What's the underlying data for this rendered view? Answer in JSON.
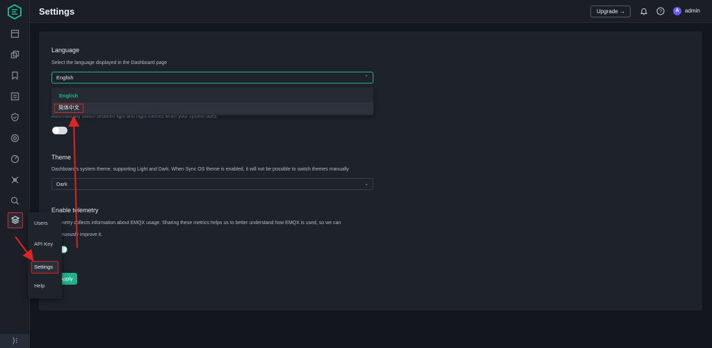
{
  "header": {
    "title": "Settings",
    "upgrade_label": "Upgrade",
    "avatar_letter": "A",
    "user": "admin"
  },
  "settings": {
    "language_label": "Language",
    "language_desc": "Select the language displayed in the Dashboard page",
    "language_value": "English",
    "language_options": [
      "English",
      "简体中文"
    ],
    "sync_desc_tail": "Automatically switch between light and night themes when your system does.",
    "theme_label": "Theme",
    "theme_desc": "Dashboard's system theme, supporting Light and Dark. When Sync OS theme is enabled, it will not be possible to switch themes manually",
    "theme_value": "Dark",
    "telemetry_label": "Enable telemetry",
    "telemetry_desc_1": "Telemetry collects information about EMQX usage. Sharing these metrics helps us to better understand how EMQX is used, so we can",
    "telemetry_desc_2": "continuously improve it.",
    "apply_label": "Apply"
  },
  "submenu": {
    "items": [
      "Users",
      "API Key",
      "Settings",
      "Help"
    ]
  },
  "collapse_glyph": "⟩⁝",
  "colors": {
    "accent": "#1fb38a",
    "highlight": "#e02424"
  }
}
